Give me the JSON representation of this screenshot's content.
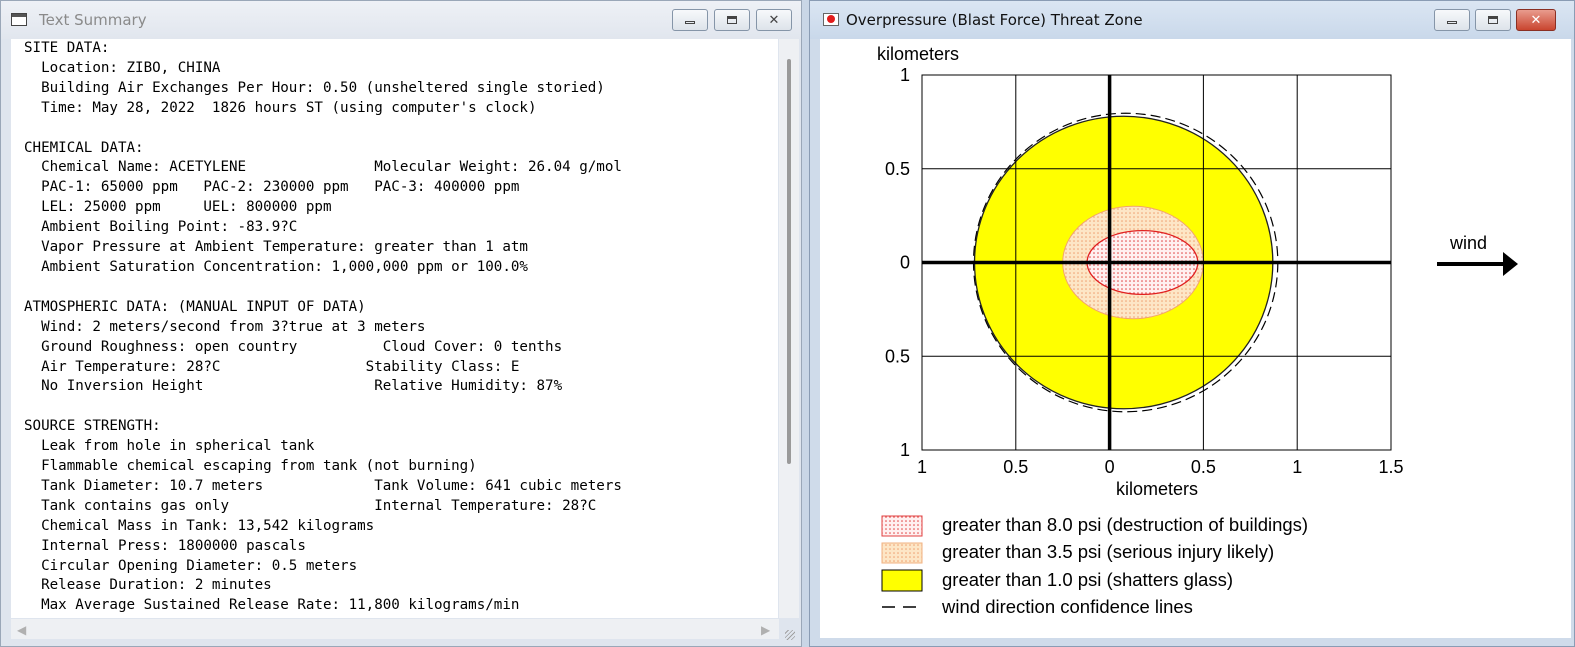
{
  "left_window": {
    "title": "Text Summary",
    "text_lines": [
      "SITE DATA:",
      "  Location: ZIBO, CHINA",
      "  Building Air Exchanges Per Hour: 0.50 (unsheltered single storied)",
      "  Time: May 28, 2022  1826 hours ST (using computer's clock)",
      "",
      "CHEMICAL DATA:",
      "  Chemical Name: ACETYLENE               Molecular Weight: 26.04 g/mol",
      "  PAC-1: 65000 ppm   PAC-2: 230000 ppm   PAC-3: 400000 ppm",
      "  LEL: 25000 ppm     UEL: 800000 ppm",
      "  Ambient Boiling Point: -83.9?C",
      "  Vapor Pressure at Ambient Temperature: greater than 1 atm",
      "  Ambient Saturation Concentration: 1,000,000 ppm or 100.0%",
      "",
      "ATMOSPHERIC DATA: (MANUAL INPUT OF DATA)",
      "  Wind: 2 meters/second from 3?true at 3 meters",
      "  Ground Roughness: open country          Cloud Cover: 0 tenths",
      "  Air Temperature: 28?C                 Stability Class: E",
      "  No Inversion Height                    Relative Humidity: 87%",
      "",
      "SOURCE STRENGTH:",
      "  Leak from hole in spherical tank",
      "  Flammable chemical escaping from tank (not burning)",
      "  Tank Diameter: 10.7 meters             Tank Volume: 641 cubic meters",
      "  Tank contains gas only                 Internal Temperature: 28?C",
      "  Chemical Mass in Tank: 13,542 kilograms",
      "  Internal Press: 1800000 pascals",
      "  Circular Opening Diameter: 0.5 meters",
      "  Release Duration: 2 minutes",
      "  Max Average Sustained Release Rate: 11,800 kilograms/min"
    ]
  },
  "right_window": {
    "title": "Overpressure (Blast Force) Threat Zone",
    "y_axis_title": "kilometers",
    "x_axis_title": "kilometers",
    "wind_label": "wind",
    "legend": [
      {
        "label": "greater than 8.0 psi (destruction of buildings)",
        "color": "#ff9c9c",
        "swatch": "red-dotted"
      },
      {
        "label": "greater than 3.5 psi (serious injury likely)",
        "color": "#ffc58a",
        "swatch": "orange-dotted"
      },
      {
        "label": "greater than 1.0 psi (shatters glass)",
        "color": "#ffff00",
        "swatch": "yellow-solid"
      },
      {
        "label": "wind direction confidence lines",
        "color": "#000000",
        "swatch": "dashed-line"
      }
    ]
  },
  "chart_data": {
    "type": "area",
    "x_tick_labels": [
      "1",
      "0.5",
      "0",
      "0.5",
      "1",
      "1.5"
    ],
    "y_tick_labels": [
      "1",
      "0.5",
      "0",
      "0.5",
      "1"
    ],
    "xlim": [
      -1,
      1.5
    ],
    "ylim": [
      -1,
      1
    ],
    "grid": true,
    "xlabel": "kilometers",
    "ylabel": "kilometers",
    "threat_zones": [
      {
        "name": "greater than 1.0 psi (shatters glass)",
        "x_min": -0.72,
        "x_max": 0.87,
        "y_min": -0.78,
        "y_max": 0.78
      },
      {
        "name": "greater than 3.5 psi (serious injury likely)",
        "x_min": -0.25,
        "x_max": 0.5,
        "y_min": -0.3,
        "y_max": 0.3
      },
      {
        "name": "greater than 8.0 psi (destruction of buildings)",
        "x_min": -0.12,
        "x_max": 0.47,
        "y_min": -0.17,
        "y_max": 0.17
      }
    ],
    "wind_direction": "right"
  }
}
